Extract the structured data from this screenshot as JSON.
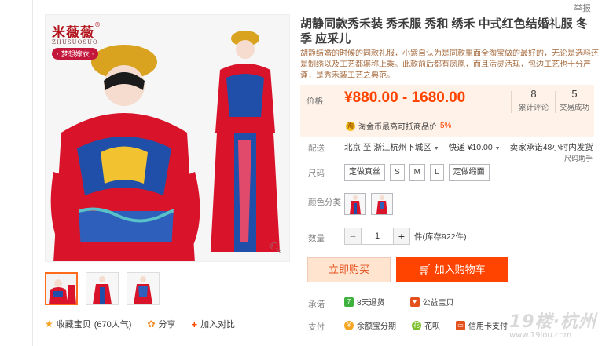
{
  "report_link": "举报",
  "brand": {
    "name": "米薇薇",
    "sub": "ZHUSUOSUO",
    "tag": "· 梦想嫁衣 ·",
    "reg": "®"
  },
  "title": "胡静同款秀禾装 秀禾服 秀和 绣禾 中式红色结婚礼服 冬季 应采儿",
  "description": "胡静结婚的时候的同款礼服，小紫自认为是同款里面全淘宝做的最好的，无论是选料还是制绣以及工艺都堪称上乘。此款前后都有凤凰，而且活灵活现，包边工艺也十分严谨，是秀禾装工艺之典范。",
  "price": {
    "label": "价格",
    "value": "¥880.00 - 1680.00",
    "reviews_count": "8",
    "reviews_label": "累计评论",
    "sales_count": "5",
    "sales_label": "交易成功",
    "coupon_text": "淘金币最高可抵商品价",
    "coupon_pct": "5%"
  },
  "shipping": {
    "label": "配送",
    "from": "北京",
    "to_word": "至",
    "to": "浙江杭州下城区",
    "express": "快递 ¥10.00",
    "promise": "卖家承诺48小时内发货",
    "helper": "尺码助手"
  },
  "size": {
    "label": "尺码",
    "options": [
      "定做真丝",
      "S",
      "M",
      "L",
      "定做缎面"
    ]
  },
  "color": {
    "label": "颜色分类"
  },
  "quantity": {
    "label": "数量",
    "value": "1",
    "minus": "−",
    "plus": "+",
    "stock": "件(库存922件)"
  },
  "buttons": {
    "buy_now": "立即购买",
    "add_cart": "加入购物车"
  },
  "promise": {
    "label": "承诺",
    "items": [
      "8天退货",
      "公益宝贝"
    ]
  },
  "payment": {
    "label": "支付",
    "items": [
      "余额宝分期",
      "花呗",
      "信用卡支付"
    ]
  },
  "actions": {
    "favorite": "收藏宝贝",
    "favorite_count": "(670人气)",
    "share": "分享",
    "compare": "加入对比"
  },
  "watermark": {
    "text": "19楼·杭州",
    "url": "www.19lou.com"
  },
  "colors": {
    "accent": "#ff4400",
    "price_bg": "#fff2e8"
  }
}
